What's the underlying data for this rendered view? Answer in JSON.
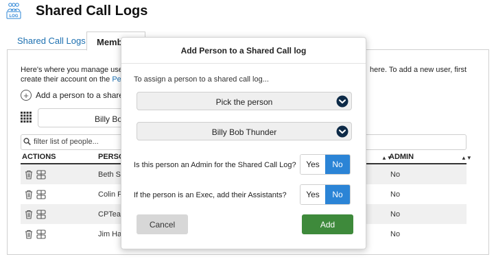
{
  "header": {
    "logo_text": "LOG",
    "title": "Shared Call Logs"
  },
  "tabs": [
    {
      "label": "Shared Call Logs",
      "active": false
    },
    {
      "label": "Memb",
      "active": true
    }
  ],
  "main": {
    "description_line1_left": "Here's where you manage users",
    "description_line1_right": "here. To add a new user, first",
    "description_line2": "create their account on the ",
    "description_link": "Peop",
    "add_person_link": "Add a person to a shared c",
    "call_log_select": "Billy Bob",
    "filter_placeholder": "filter list of people...",
    "columns": {
      "actions": "ACTIONS",
      "person": "PERSON",
      "admin": "ADMIN"
    },
    "rows": [
      {
        "person": "Beth Su",
        "admin": "No"
      },
      {
        "person": "Colin Fa",
        "admin": "No"
      },
      {
        "person": "CPTeam",
        "admin": "No"
      },
      {
        "person": "Jim Hav",
        "admin": "No"
      }
    ]
  },
  "modal": {
    "title": "Add Person to a Shared Call log",
    "intro": "To assign a person to a shared call log...",
    "person_select": "Pick the person",
    "call_log_select": "Billy Bob Thunder",
    "admin_question": "Is this person an Admin for the Shared Call Log?",
    "exec_question": "If the person is an Exec, add their Assistants?",
    "yes_label": "Yes",
    "no_label": "No",
    "cancel_label": "Cancel",
    "add_label": "Add"
  },
  "colors": {
    "link": "#1b6fb0",
    "toggle_selected": "#2b84d6",
    "add_button": "#3e8a3b",
    "select_chevron": "#0d2a47"
  }
}
